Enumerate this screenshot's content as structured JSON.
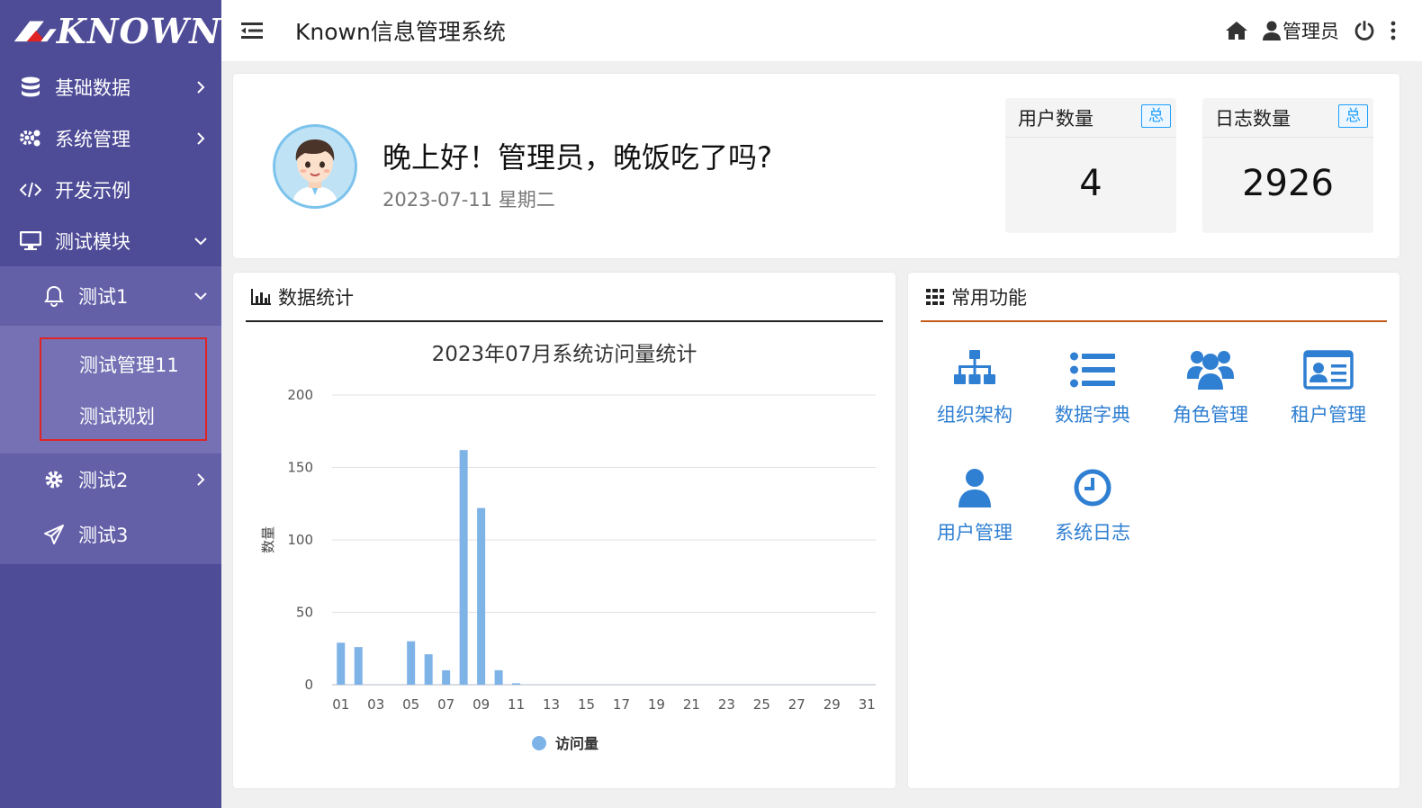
{
  "brand": {
    "logo_text": "KNOWN"
  },
  "header": {
    "title": "Known信息管理系统",
    "user_label": "管理员"
  },
  "sidebar": {
    "items": [
      {
        "label": "基础数据",
        "icon": "database-icon"
      },
      {
        "label": "系统管理",
        "icon": "cogs-icon"
      },
      {
        "label": "开发示例",
        "icon": "code-icon"
      },
      {
        "label": "测试模块",
        "icon": "desktop-icon"
      }
    ],
    "sub": [
      {
        "label": "测试1",
        "icon": "bell-icon"
      }
    ],
    "subsub": [
      {
        "label": "测试管理11"
      },
      {
        "label": "测试规划"
      }
    ],
    "sub_after": [
      {
        "label": "测试2",
        "icon": "gear-icon"
      },
      {
        "label": "测试3",
        "icon": "paper-plane-icon"
      }
    ]
  },
  "welcome": {
    "greeting": "晚上好！管理员，晚饭吃了吗?",
    "date": "2023-07-11 星期二"
  },
  "stats": [
    {
      "label": "用户数量",
      "badge": "总",
      "value": "4"
    },
    {
      "label": "日志数量",
      "badge": "总",
      "value": "2926"
    }
  ],
  "chart_panel": {
    "title": "数据统计"
  },
  "functions_panel": {
    "title": "常用功能",
    "items": [
      {
        "label": "组织架构",
        "icon": "sitemap-icon"
      },
      {
        "label": "数据字典",
        "icon": "list-icon"
      },
      {
        "label": "角色管理",
        "icon": "users-icon"
      },
      {
        "label": "租户管理",
        "icon": "id-card-icon"
      },
      {
        "label": "用户管理",
        "icon": "user-icon"
      },
      {
        "label": "系统日志",
        "icon": "clock-icon"
      }
    ]
  },
  "colors": {
    "sidebar": "#4e4b97",
    "accent": "#2f7fd2",
    "bar": "#7eb3e8"
  },
  "chart_data": {
    "type": "bar",
    "title": "2023年07月系统访问量统计",
    "ylabel": "数量",
    "xlabel": "",
    "ylim": [
      0,
      200
    ],
    "yticks": [
      0,
      50,
      100,
      150,
      200
    ],
    "categories": [
      "01",
      "02",
      "03",
      "04",
      "05",
      "06",
      "07",
      "08",
      "09",
      "10",
      "11",
      "12",
      "13",
      "14",
      "15",
      "16",
      "17",
      "18",
      "19",
      "20",
      "21",
      "22",
      "23",
      "24",
      "25",
      "26",
      "27",
      "28",
      "29",
      "30",
      "31"
    ],
    "xtick_labels": [
      "01",
      "03",
      "05",
      "07",
      "09",
      "11",
      "13",
      "15",
      "17",
      "19",
      "21",
      "23",
      "25",
      "27",
      "29",
      "31"
    ],
    "series": [
      {
        "name": "访问量",
        "values": [
          29,
          26,
          0,
          0,
          30,
          21,
          10,
          162,
          122,
          10,
          1,
          0,
          0,
          0,
          0,
          0,
          0,
          0,
          0,
          0,
          0,
          0,
          0,
          0,
          0,
          0,
          0,
          0,
          0,
          0,
          0
        ]
      }
    ]
  }
}
